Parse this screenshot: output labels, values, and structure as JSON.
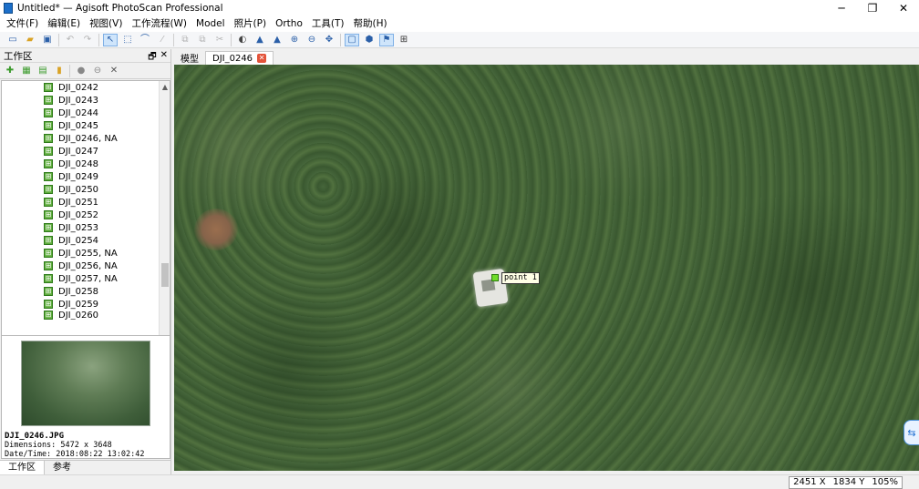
{
  "window": {
    "title": "Untitled* — Agisoft PhotoScan Professional",
    "minimize_icon": "─",
    "restore_icon": "❐",
    "close_icon": "✕"
  },
  "menu": [
    "文件(F)",
    "编辑(E)",
    "视图(V)",
    "工作流程(W)",
    "Model",
    "照片(P)",
    "Ortho",
    "工具(T)",
    "帮助(H)"
  ],
  "workspace": {
    "title": "工作区",
    "float_icon": "🗗",
    "close_icon": "✕",
    "items": [
      "DJI_0242",
      "DJI_0243",
      "DJI_0244",
      "DJI_0245",
      "DJI_0246, NA",
      "DJI_0247",
      "DJI_0248",
      "DJI_0249",
      "DJI_0250",
      "DJI_0251",
      "DJI_0252",
      "DJI_0253",
      "DJI_0254",
      "DJI_0255, NA",
      "DJI_0256, NA",
      "DJI_0257, NA",
      "DJI_0258",
      "DJI_0259",
      "DJI_0260"
    ]
  },
  "photo_info": {
    "filename": "DJI_0246.JPG",
    "dimensions": "Dimensions: 5472 x 3648",
    "datetime": "Date/Time: 2018:08:22 13:02:42"
  },
  "bottom_tabs": [
    "工作区",
    "参考"
  ],
  "view_tabs": {
    "model": "模型",
    "photo": "DJI_0246",
    "close_icon": "✕"
  },
  "marker": {
    "label": "point 1"
  },
  "status": {
    "x": "2451 X",
    "y": "1834 Y",
    "zoom": "105%"
  },
  "icons": {
    "toolbar": [
      "new-icon",
      "open-icon",
      "save-icon",
      "undo-icon",
      "redo-icon",
      "select-icon",
      "rect-select-icon",
      "brush-icon",
      "ruler-icon",
      "copy-icon",
      "paste-icon",
      "cut-icon",
      "circle-icon",
      "mountains-icon",
      "zoom-in-icon",
      "zoom-out-icon",
      "move-icon",
      "view-icon",
      "marker-icon",
      "flag-icon",
      "grid-icon"
    ],
    "side_button": "remote-icon"
  },
  "colors": {
    "marker": "#6fdc2a",
    "tab_close": "#e3533a",
    "accent": "#1c6fc9"
  }
}
